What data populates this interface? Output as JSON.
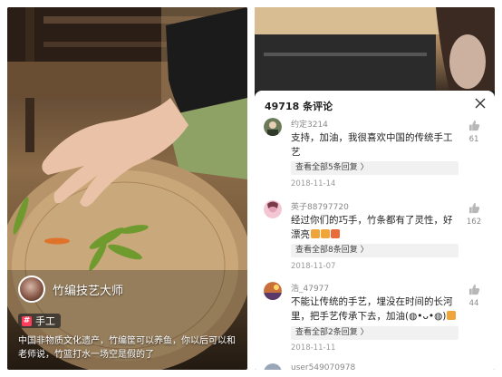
{
  "left_panel": {
    "creator_name": "竹编技艺大师",
    "tag_hash": "#",
    "tag_label": "手工",
    "caption": "中国非物质文化遗产，竹编筐可以养鱼，你以后可以和老师说，竹篮打水一场空是假的了"
  },
  "comments_panel": {
    "title": "49718 条评论",
    "comments": [
      {
        "user": "约定3214",
        "text": "支持，加油，我很喜欢中国的传统手工艺",
        "more": "查看全部5条回复",
        "date": "2018-11-14",
        "likes": "61"
      },
      {
        "user": "英子88797720",
        "text": "经过你们的巧手，竹条都有了灵性，好漂亮",
        "more": "查看全部8条回复",
        "date": "2018-11-07",
        "likes": "162"
      },
      {
        "user": "浩_47977",
        "text": "不能让传统的手艺，埋没在时间的长河里，把手艺传承下去，加油(◍•ᴗ•◍)",
        "more": "查看全部2条回复",
        "date": "2018-11-11",
        "likes": "44"
      },
      {
        "user": "user549070978"
      }
    ]
  },
  "colors": {
    "tag_hash": "#ff3d5a",
    "accent_emoji": "#f0a53a"
  }
}
